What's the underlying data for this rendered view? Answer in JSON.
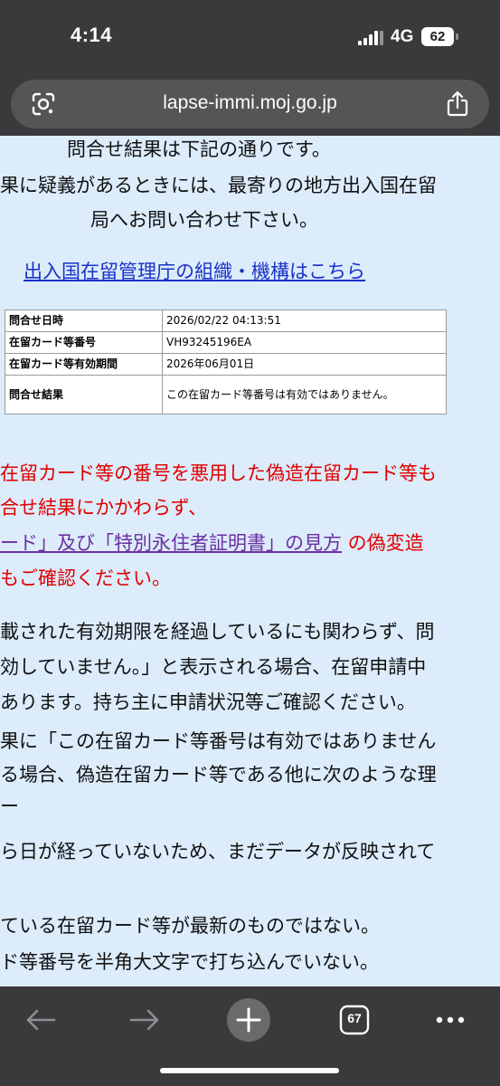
{
  "status": {
    "time": "4:14",
    "network": "4G",
    "battery": "62"
  },
  "browser": {
    "url": "lapse-immi.moj.go.jp",
    "tab_count": "67"
  },
  "intro": {
    "line1": "問合せ結果は下記の通りです。",
    "line2": "果に疑義があるときには、最寄りの地方出入国在留",
    "line3": "局へお問い合わせ下さい。"
  },
  "org_link": "出入国在留管理庁の組織・機構はこちら",
  "result_table": [
    {
      "label": "問合せ日時",
      "value": "2026/02/22 04:13:51"
    },
    {
      "label": "在留カード等番号",
      "value": "VH93245196EA"
    },
    {
      "label": "在留カード等有効期間",
      "value": "2026年06月01日"
    },
    {
      "label": "問合せ結果",
      "value": "この在留カード等番号は有効ではありません。"
    }
  ],
  "warning": {
    "line1": "在留カード等の番号を悪用した偽造在留カード等も",
    "line2": "合せ結果にかかわらず、",
    "line3_link": "ード」及び「特別永住者証明書」の見方",
    "line3_rest": " の偽変造",
    "line4": "もご確認ください。"
  },
  "notes": {
    "line1": "載された有効期限を経過しているにも関わらず、問",
    "line2": "効していません。」と表示される場合、在留申請中",
    "line3": "あります。持ち主に申請状況等ご確認ください。",
    "line4": "果に「この在留カード等番号は有効ではありません",
    "line5": "る場合、偽造在留カード等である他に次のような理",
    "line6": "ー",
    "line7": "ら日が経っていないため、まだデータが反映されて",
    "line8": "ている在留カード等が最新のものではない。",
    "line9": "ド等番号を半角大文字で打ち込んでいない。"
  },
  "icons": {
    "lens": "google-lens-icon",
    "share": "share-icon",
    "back": "back-arrow-icon",
    "forward": "forward-arrow-icon",
    "new_tab": "plus-icon",
    "tabs": "tab-switcher-icon",
    "menu": "more-icon"
  },
  "colors": {
    "page_bg": "#dcecfb",
    "warning_red": "#e00000",
    "link_blue": "#1a31c8",
    "link_purple": "#6b2fa0"
  }
}
